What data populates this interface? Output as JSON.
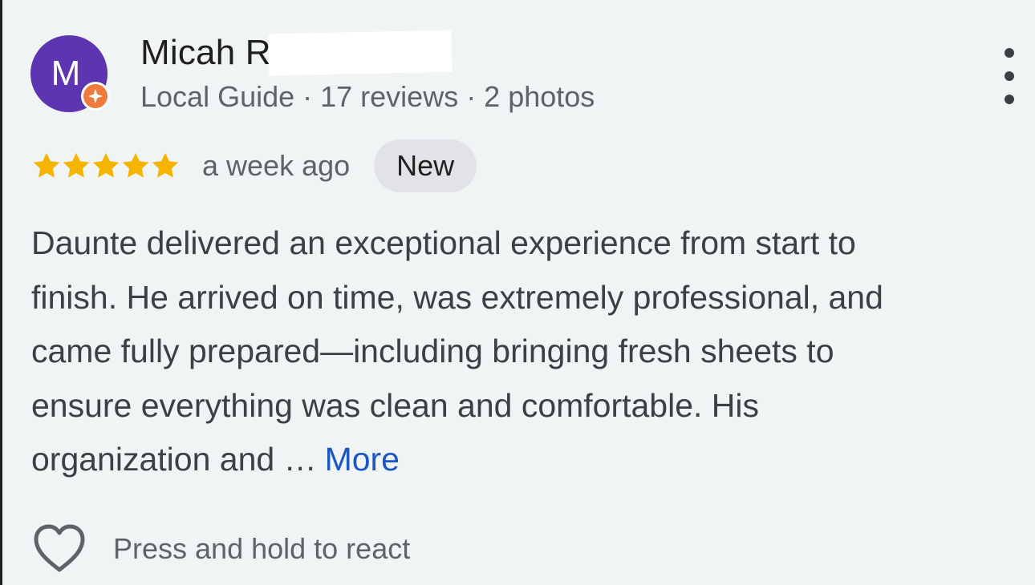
{
  "reviewer": {
    "initial": "M",
    "name": "Micah R",
    "meta": "Local Guide · 17 reviews · 2 photos"
  },
  "review": {
    "stars": 5,
    "time_ago": "a week ago",
    "badge": "New",
    "text_lines": [
      "Daunte delivered an exceptional experience from start to",
      "finish. He arrived on time, was extremely professional, and",
      "came fully prepared—including bringing fresh sheets to",
      "ensure everything was clean and comfortable. His",
      "organization and …"
    ],
    "more_label": "More"
  },
  "actions": {
    "react_label": "Press and hold to react"
  },
  "icons": {
    "menu": "more-vert-icon",
    "star": "star-icon",
    "heart": "heart-outline-icon",
    "local_guide": "local-guide-badge-icon"
  },
  "colors": {
    "avatar": "#5e35b1",
    "local_guide_badge": "#ee7b3c",
    "star": "#f4b400",
    "link": "#1a56c4",
    "badge_bg": "#e1e3e6",
    "card_bg": "#f1f4f5"
  }
}
